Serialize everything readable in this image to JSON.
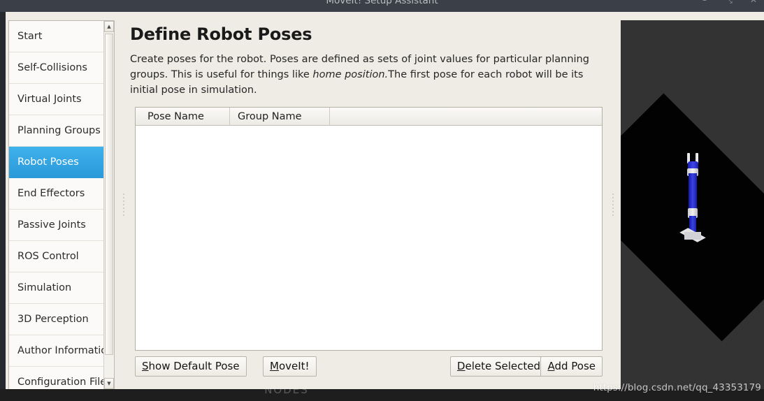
{
  "window": {
    "title": "MoveIt! Setup Assistant",
    "controls": [
      {
        "name": "minimize",
        "glyph": "–"
      },
      {
        "name": "maximize",
        "glyph": "⤡"
      },
      {
        "name": "close",
        "glyph": "✕"
      }
    ]
  },
  "sidebar": {
    "items": [
      {
        "label": "Start",
        "selected": false
      },
      {
        "label": "Self-Collisions",
        "selected": false
      },
      {
        "label": "Virtual Joints",
        "selected": false
      },
      {
        "label": "Planning Groups",
        "selected": false
      },
      {
        "label": "Robot Poses",
        "selected": true
      },
      {
        "label": "End Effectors",
        "selected": false
      },
      {
        "label": "Passive Joints",
        "selected": false
      },
      {
        "label": "ROS Control",
        "selected": false
      },
      {
        "label": "Simulation",
        "selected": false
      },
      {
        "label": "3D Perception",
        "selected": false
      },
      {
        "label": "Author Information",
        "selected": false
      },
      {
        "label": "Configuration Files",
        "selected": false
      }
    ],
    "scroll_up_glyph": "▲",
    "scroll_down_glyph": "▼"
  },
  "main": {
    "title": "Define Robot Poses",
    "description_part1": "Create poses for the robot. Poses are defined as sets of joint values for particular planning groups. This is useful for things like ",
    "description_emphasis": "home position.",
    "description_part2": "The first pose for each robot will be its initial pose in simulation.",
    "table": {
      "columns": [
        "Pose Name",
        "Group Name"
      ],
      "rows": []
    },
    "buttons": {
      "show_default_pose": {
        "mnemonic": "S",
        "rest": "how Default Pose"
      },
      "moveit": {
        "mnemonic": "M",
        "rest": "oveIt!"
      },
      "delete_selected": {
        "mnemonic": "D",
        "rest": "elete Selected"
      },
      "add_pose": {
        "mnemonic": "A",
        "rest": "dd Pose"
      }
    }
  },
  "view3d": {
    "background_color": "#333333",
    "ground_color": "#020202",
    "robot_link_color": "#2a32c8",
    "robot_joint_color": "#e4e4e6"
  },
  "bottom": {
    "nodes_label": "NODES",
    "watermark": "https://blog.csdn.net/qq_43353179"
  }
}
